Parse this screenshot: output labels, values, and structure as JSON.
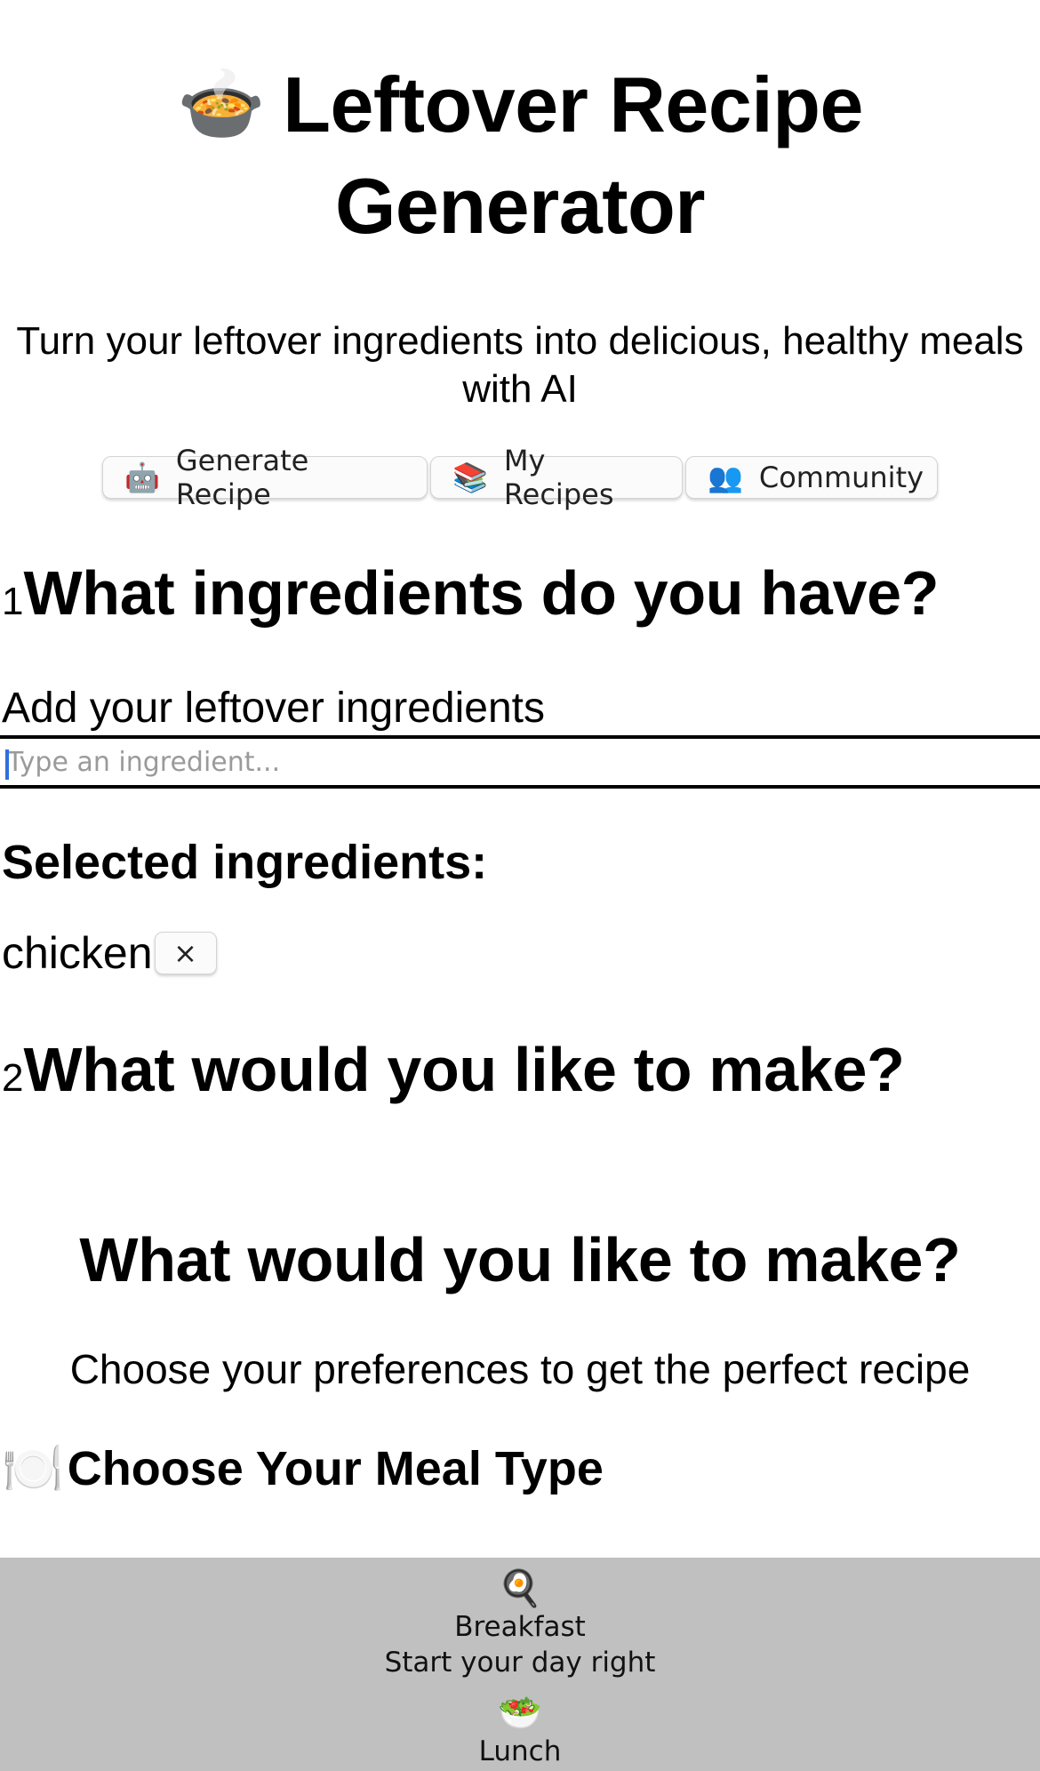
{
  "header": {
    "logo_icon": "🍲",
    "title": "Leftover Recipe Generator",
    "subtitle": "Turn your leftover ingredients into delicious, healthy meals with AI"
  },
  "nav": {
    "tabs": [
      {
        "icon": "🤖",
        "icon_name": "robot-icon",
        "label": "Generate Recipe"
      },
      {
        "icon": "📚",
        "icon_name": "books-icon",
        "label": "My Recipes"
      },
      {
        "icon": "👥",
        "icon_name": "people-icon",
        "label": "Community"
      }
    ]
  },
  "step1": {
    "number": "1",
    "title": "What ingredients do you have?",
    "input_label": "Add your leftover ingredients",
    "input_placeholder": "Type an ingredient...",
    "input_value": "",
    "selected_heading": "Selected ingredients:",
    "selected": [
      {
        "name": "chicken",
        "remove_label": "×"
      }
    ]
  },
  "step2": {
    "number": "2",
    "title": "What would you like to make?",
    "section_title": "What would you like to make?",
    "section_subtitle": "Choose your preferences to get the perfect recipe",
    "meal_type_icon": "🍽️",
    "meal_type_heading": "Choose Your Meal Type",
    "meal_options": [
      {
        "icon": "🍳",
        "icon_name": "frying-pan-icon",
        "name": "Breakfast",
        "description": "Start your day right"
      },
      {
        "icon": "🥗",
        "icon_name": "salad-icon",
        "name": "Lunch",
        "description": ""
      }
    ]
  },
  "colors": {
    "meal_panel_bg": "#c0c0c0",
    "caret": "#2f6fde"
  }
}
